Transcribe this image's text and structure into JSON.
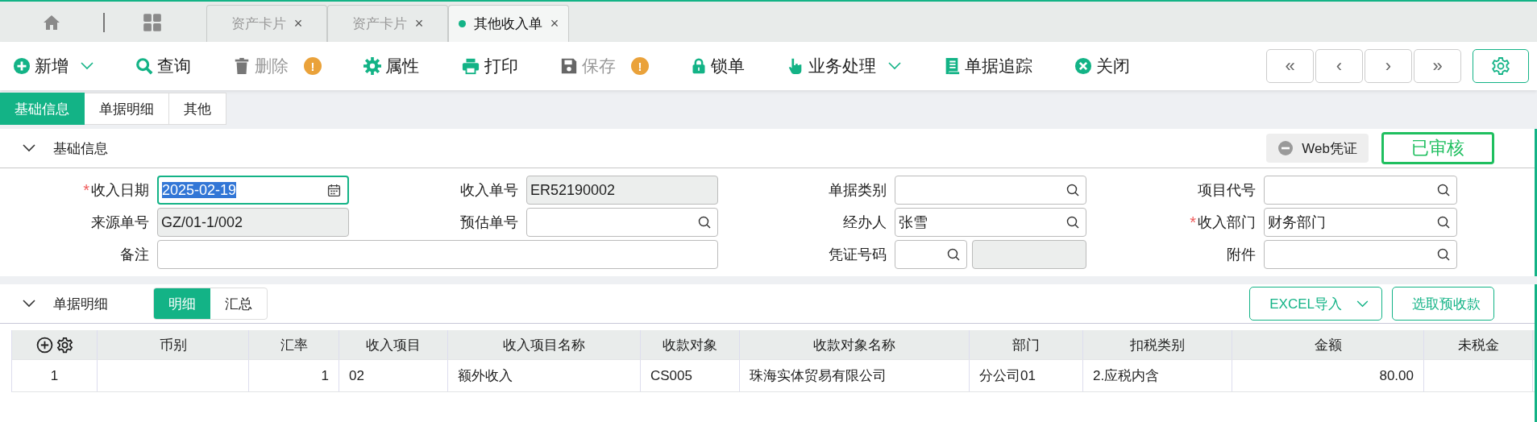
{
  "tab_bar": {
    "tabs": [
      {
        "label": "资产卡片",
        "close": "×",
        "selected": false
      },
      {
        "label": "资产卡片",
        "close": "×",
        "selected": false
      },
      {
        "label": "其他收入单",
        "close": "×",
        "selected": true
      }
    ]
  },
  "toolbar": {
    "items": [
      {
        "label": "新增",
        "dropdown": true,
        "disabled": false
      },
      {
        "label": "查询",
        "dropdown": false,
        "disabled": false
      },
      {
        "label": "删除",
        "dropdown": false,
        "disabled": true,
        "alert": "!"
      },
      {
        "label": "属性",
        "dropdown": false,
        "disabled": false
      },
      {
        "label": "打印",
        "dropdown": false,
        "disabled": false
      },
      {
        "label": "保存",
        "dropdown": false,
        "disabled": true,
        "alert": "!"
      },
      {
        "label": "锁单",
        "dropdown": false,
        "disabled": false
      },
      {
        "label": "业务处理",
        "dropdown": true,
        "disabled": false
      },
      {
        "label": "单据追踪",
        "dropdown": false,
        "disabled": false
      },
      {
        "label": "关闭",
        "dropdown": false,
        "disabled": false
      }
    ],
    "nav": [
      "«",
      "‹",
      "›",
      "»"
    ]
  },
  "view_tabs": [
    {
      "label": "基础信息",
      "selected": true
    },
    {
      "label": "单据明细",
      "selected": false
    },
    {
      "label": "其他",
      "selected": false
    }
  ],
  "basic_info": {
    "title": "基础信息",
    "expanded": true,
    "voucher_button": "Web凭证",
    "status": "已审核",
    "fields": [
      {
        "label": "收入日期",
        "required_mark": "*",
        "kind": "date",
        "value": "2025-02-19",
        "focused": true
      },
      {
        "label": "收入单号",
        "kind": "readonly",
        "value": "ER52190002",
        "focused": false
      },
      {
        "label": "单据类别",
        "kind": "lookup",
        "focused": false
      },
      {
        "label": "项目代号",
        "kind": "lookup",
        "focused": false
      },
      {
        "label": "来源单号",
        "kind": "readonly",
        "value": "GZ/01-1/002",
        "focused": false
      },
      {
        "label": "预估单号",
        "kind": "lookup",
        "focused": false
      },
      {
        "label": "经办人",
        "kind": "lookup",
        "value": "张雪",
        "focused": false
      },
      {
        "label": "收入部门",
        "required_mark": "*",
        "kind": "lookup",
        "value": "财务部门",
        "focused": false
      },
      {
        "label": "备注",
        "kind": "memo",
        "focused": false
      },
      {
        "label": "凭证号码",
        "kind": "lookup_pair",
        "focused": false
      },
      {
        "label": "附件",
        "kind": "lookup",
        "focused": false
      }
    ]
  },
  "detail": {
    "title": "单据明细",
    "expanded": true,
    "views": [
      {
        "label": "明细",
        "selected": true
      },
      {
        "label": "汇总",
        "selected": false
      }
    ],
    "buttons": [
      {
        "label": "EXCEL导入",
        "dropdown": true
      },
      {
        "label": "选取预收款",
        "dropdown": false
      }
    ],
    "table": {
      "columns": [
        {
          "label": "币别",
          "numeric": false
        },
        {
          "label": "汇率",
          "numeric": true
        },
        {
          "label": "收入项目",
          "numeric": false
        },
        {
          "label": "收入项目名称",
          "numeric": false
        },
        {
          "label": "收款对象",
          "numeric": false
        },
        {
          "label": "收款对象名称",
          "numeric": false
        },
        {
          "label": "部门",
          "numeric": false
        },
        {
          "label": "扣税类别",
          "numeric": false
        },
        {
          "label": "金额",
          "numeric": true
        },
        {
          "label": "未税金",
          "numeric": false
        }
      ],
      "rows": [
        {
          "index": "1",
          "cells": [
            null,
            "1",
            "02",
            "额外收入",
            "CS005",
            "珠海实体贸易有限公司",
            "分公司01",
            "2.应税内含",
            "80.00",
            null
          ]
        }
      ]
    }
  }
}
